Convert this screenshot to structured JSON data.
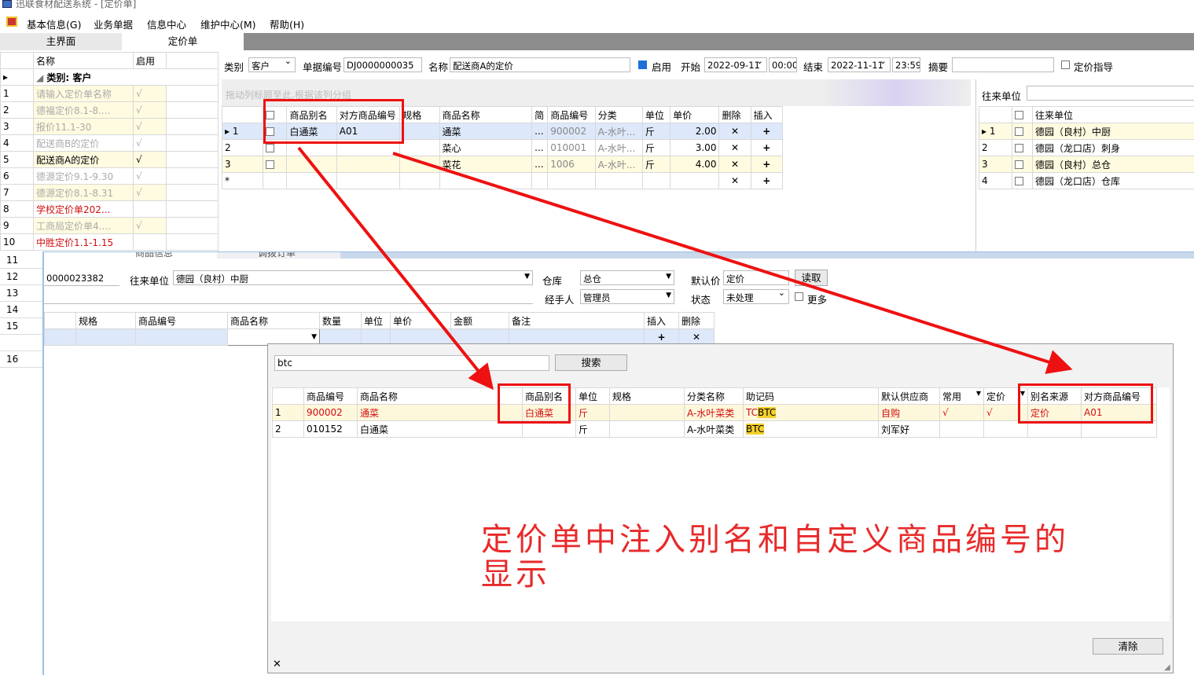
{
  "window": {
    "title": "迅联食材配送系统 - [定价单]"
  },
  "menu": [
    "基本信息(G)",
    "业务单据",
    "信息中心",
    "维护中心(M)",
    "帮助(H)"
  ],
  "tabs": [
    "主界面",
    "定价单"
  ],
  "left_list": {
    "headers": [
      "名称",
      "启用"
    ],
    "group": "类别: 客户",
    "rows": [
      {
        "n": "1",
        "name": "请输入定价单名称",
        "en": "√"
      },
      {
        "n": "2",
        "name": "德福定价8.1-8....",
        "en": "√"
      },
      {
        "n": "3",
        "name": "报价11.1-30",
        "en": "√"
      },
      {
        "n": "4",
        "name": "配送商B的定价",
        "en": "√"
      },
      {
        "n": "5",
        "name": "配送商A的定价",
        "en": "√"
      },
      {
        "n": "6",
        "name": "德源定价9.1-9.30",
        "en": "√"
      },
      {
        "n": "7",
        "name": "德源定价8.1-8.31",
        "en": "√"
      },
      {
        "n": "8",
        "name": "学校定价单202...",
        "en": ""
      },
      {
        "n": "9",
        "name": "工商局定价单4....",
        "en": "√"
      },
      {
        "n": "10",
        "name": "中胜定价1.1-1.15",
        "en": ""
      }
    ],
    "more_rows": [
      "11",
      "12",
      "13",
      "14",
      "15",
      "16"
    ]
  },
  "form": {
    "category_label": "类别",
    "category_value": "客户",
    "docno_label": "单据编号",
    "docno_value": "DJ0000000035",
    "name_label": "名称",
    "name_value": "配送商A的定价",
    "enabled_label": "启用",
    "start_label": "开始",
    "start_date": "2022-09-11",
    "start_time": "00:00",
    "end_label": "结束",
    "end_date": "2022-11-11",
    "end_time": "23:59",
    "summary_label": "摘要",
    "guide_label": "定价指导",
    "group_hint": "拖动列标题至此,根据该列分组",
    "partner_label": "往来单位"
  },
  "price_grid": {
    "headers": [
      "商品别名",
      "对方商品编号",
      "规格",
      "商品名称",
      "简",
      "商品编号",
      "分类",
      "单位",
      "单价",
      "删除",
      "插入"
    ],
    "rows": [
      {
        "n": "1",
        "alias": "白通菜",
        "code2": "A01",
        "spec": "",
        "name": "通菜",
        "dots": "...",
        "code": "900002",
        "cat": "A-水叶...",
        "unit": "斤",
        "price": "2.00"
      },
      {
        "n": "2",
        "alias": "",
        "code2": "",
        "spec": "",
        "name": "菜心",
        "dots": "...",
        "code": "010001",
        "cat": "A-水叶...",
        "unit": "斤",
        "price": "3.00"
      },
      {
        "n": "3",
        "alias": "",
        "code2": "",
        "spec": "",
        "name": "菜花",
        "dots": "...",
        "code": "1006",
        "cat": "A-水叶...",
        "unit": "斤",
        "price": "4.00"
      }
    ],
    "new_row": "*",
    "del": "✕",
    "ins": "+"
  },
  "partner_grid": {
    "header": "往来单位",
    "rows": [
      {
        "n": "1",
        "name": "德园（良村）中厨"
      },
      {
        "n": "2",
        "name": "德园（龙口店）刺身"
      },
      {
        "n": "3",
        "name": "德园（良村）总仓"
      },
      {
        "n": "4",
        "name": "德园（龙口店）仓库"
      }
    ]
  },
  "order": {
    "tabs": [
      "商品信息",
      "调拨订单"
    ],
    "docno": "0000023382",
    "partner_label": "往来单位",
    "partner_value": "德园（良村）中厨",
    "warehouse_label": "仓库",
    "warehouse_value": "总仓",
    "default_price_label": "默认价",
    "default_price_value": "定价",
    "read_btn": "读取",
    "handler_label": "经手人",
    "handler_value": "管理员",
    "status_label": "状态",
    "status_value": "未处理",
    "more_label": "更多",
    "headers": [
      "规格",
      "商品编号",
      "商品名称",
      "数量",
      "单位",
      "单价",
      "金额",
      "备注",
      "插入",
      "删除"
    ],
    "ins": "+",
    "del": "✕"
  },
  "search": {
    "query": "btc",
    "search_btn": "搜索",
    "clear_btn": "清除",
    "close": "✕",
    "headers": [
      "商品编号",
      "商品名称",
      "商品别名",
      "单位",
      "规格",
      "分类名称",
      "助记码",
      "默认供应商",
      "常用",
      "定价",
      "别名来源",
      "对方商品编号"
    ],
    "rows": [
      {
        "n": "1",
        "code": "900002",
        "name": "通菜",
        "alias": "白通菜",
        "unit": "斤",
        "spec": "",
        "cat": "A-水叶菜类",
        "mnem_pre": "TC",
        "mnem_hl": "BTC",
        "supplier": "自购",
        "common": "√",
        "priced": "√",
        "src": "定价",
        "code2": "A01"
      },
      {
        "n": "2",
        "code": "010152",
        "name": "白通菜",
        "alias": "",
        "unit": "斤",
        "spec": "",
        "cat": "A-水叶菜类",
        "mnem_pre": "",
        "mnem_hl": "BTC",
        "supplier": "刘军好",
        "common": "",
        "priced": "",
        "src": "",
        "code2": ""
      }
    ]
  },
  "annotation": {
    "text": "定价单中注入别名和自定义商品编号的显示"
  },
  "colors": {
    "annotation": "#e82a2a",
    "highlight": "#f4d02a",
    "tabstrip": "#8c8c8c"
  }
}
